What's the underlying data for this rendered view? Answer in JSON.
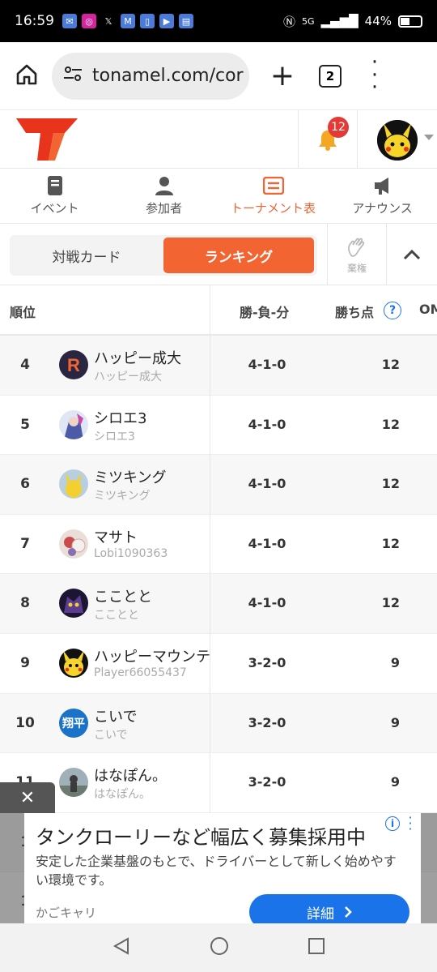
{
  "status": {
    "time": "16:59",
    "network": "5G",
    "battery": "44%"
  },
  "browser": {
    "url": "tonamel.com/cor",
    "tab_count": "2"
  },
  "header": {
    "notification_count": "12"
  },
  "nav": {
    "tabs": [
      {
        "label": "イベント",
        "icon": "event-icon"
      },
      {
        "label": "参加者",
        "icon": "person-icon"
      },
      {
        "label": "トーナメント表",
        "icon": "bracket-icon"
      },
      {
        "label": "アナウンス",
        "icon": "megaphone-icon"
      }
    ],
    "active_index": 2
  },
  "segment": {
    "match_cards": "対戦カード",
    "ranking": "ランキング",
    "forfeit": "棄権"
  },
  "table": {
    "headers": {
      "rank": "順位",
      "wld": "勝-負-分",
      "points": "勝ち点",
      "extra": "OM"
    },
    "rows": [
      {
        "rank": "4",
        "name": "ハッピー成大",
        "sub": "ハッピー成大",
        "wld": "4-1-0",
        "points": "12",
        "avatar": "letter-r-avatar"
      },
      {
        "rank": "5",
        "name": "シロエ3",
        "sub": "シロエ3",
        "wld": "4-1-0",
        "points": "12",
        "avatar": "anime-avatar"
      },
      {
        "rank": "6",
        "name": "ミツキング",
        "sub": "ミツキング",
        "wld": "4-1-0",
        "points": "12",
        "avatar": "pikachu-figure-avatar"
      },
      {
        "rank": "7",
        "name": "マサト",
        "sub": "Lobi1090363",
        "wld": "4-1-0",
        "points": "12",
        "avatar": "plush-avatar"
      },
      {
        "rank": "8",
        "name": "こことと",
        "sub": "こことと",
        "wld": "4-1-0",
        "points": "12",
        "avatar": "dark-creature-avatar"
      },
      {
        "rank": "9",
        "name": "ハッピーマウンテン",
        "sub": "Player66055437",
        "wld": "3-2-0",
        "points": "9",
        "avatar": "pikachu-avatar"
      },
      {
        "rank": "10",
        "name": "こいで",
        "sub": "こいで",
        "wld": "3-2-0",
        "points": "9",
        "avatar": "shohei-avatar",
        "avatar_text": "翔平"
      },
      {
        "rank": "11",
        "name": "はなぽん。",
        "sub": "はなぽん。",
        "wld": "3-2-0",
        "points": "9",
        "avatar": "photo-avatar"
      },
      {
        "rank": "1",
        "name": "",
        "sub": "",
        "wld": "",
        "points": "",
        "avatar": "none"
      },
      {
        "rank": "1",
        "name": "",
        "sub": "",
        "wld": "",
        "points": "",
        "avatar": "none"
      }
    ]
  },
  "ad": {
    "title": "タンクローリーなど幅広く募集採用中",
    "body": "安定した企業基盤のもとで、ドライバーとして新しく始めやすい環境です。",
    "source": "かごキャリ",
    "button": "詳細"
  },
  "colors": {
    "accent": "#f26532",
    "ad_button": "#1a73e8",
    "badge": "#e53935"
  }
}
